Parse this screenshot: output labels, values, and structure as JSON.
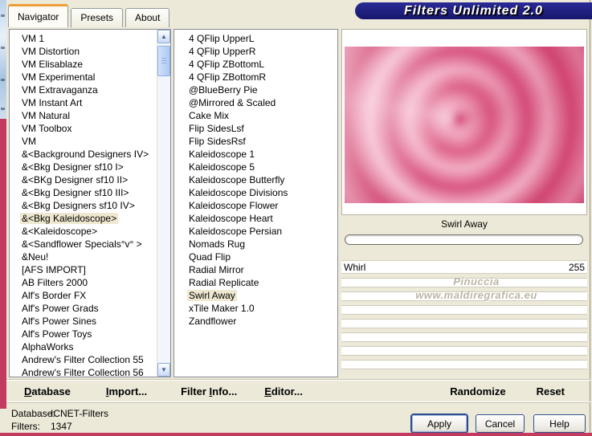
{
  "window": {
    "banner_title": "Filters Unlimited 2.0"
  },
  "tabs": {
    "navigator": {
      "label": "Navigator"
    },
    "presets": {
      "label": "Presets"
    },
    "about": {
      "label": "About"
    }
  },
  "left_list": {
    "items": [
      "VM 1",
      "VM Distortion",
      "VM Elisablaze",
      "VM Experimental",
      "VM Extravaganza",
      "VM Instant Art",
      "VM Natural",
      "VM Toolbox",
      "VM",
      "&<Background Designers IV>",
      "&<Bkg Designer sf10 I>",
      "&<BKg Designer sf10 II>",
      "&<Bkg Designer sf10 III>",
      "&<Bkg Designers sf10 IV>",
      {
        "label": "&<Bkg Kaleidoscope>",
        "selected": true
      },
      "&<Kaleidoscope>",
      "&<Sandflower Specials°v° >",
      "&Neu!",
      "[AFS IMPORT]",
      "AB Filters 2000",
      "Alf's Border FX",
      "Alf's Power Grads",
      "Alf's Power Sines",
      "Alf's Power Toys",
      "AlphaWorks",
      "Andrew's Filter Collection 55",
      "Andrew's Filter Collection 56"
    ]
  },
  "middle_list": {
    "items": [
      "4 QFlip UpperL",
      "4 QFlip UpperR",
      "4 QFlip ZBottomL",
      "4 QFlip ZBottomR",
      "@BlueBerry Pie",
      "@Mirrored & Scaled",
      "Cake Mix",
      "Flip SidesLsf",
      "Flip SidesRsf",
      "Kaleidoscope 1",
      "Kaleidoscope 5",
      "Kaleidoscope Butterfly",
      "Kaleidoscope Divisions",
      "Kaleidoscope Flower",
      "Kaleidoscope Heart",
      "Kaleidoscope Persian",
      "Nomads Rug",
      "Quad Flip",
      "Radial Mirror",
      "Radial Replicate",
      {
        "label": "Swirl Away",
        "selected": true
      },
      "xTile Maker 1.0",
      "Zandflower"
    ]
  },
  "preview": {
    "selected_filter_title": "Swirl Away"
  },
  "parameters": {
    "rows": [
      {
        "name": "Whirl",
        "value": "255"
      }
    ]
  },
  "watermark": {
    "line1": "Pinuccia",
    "line2": "www.maldiregrafica.eu"
  },
  "toolbar": {
    "database": {
      "pre": "",
      "accel": "D",
      "post": "atabase"
    },
    "import": {
      "pre": "",
      "accel": "I",
      "post": "mport..."
    },
    "filter_info": {
      "pre": "Filter ",
      "accel": "I",
      "post": "nfo..."
    },
    "editor": {
      "pre": "",
      "accel": "E",
      "post": "ditor..."
    },
    "randomize": {
      "label": "Randomize"
    },
    "reset": {
      "label": "Reset"
    }
  },
  "status": {
    "database_label": "Database:",
    "database_value": "ICNET-Filters",
    "filters_label": "Filters:",
    "filters_value": "1347"
  },
  "buttons": {
    "apply": "Apply",
    "cancel": "Cancel",
    "help": "Help"
  },
  "icons": {
    "scroll_up": "▲",
    "scroll_down": "▼"
  },
  "colors": {
    "banner_navy": "#1b1b7a",
    "desktop_stripe_red": "#c23a5f",
    "selection_highlight": "#efe8d0",
    "swirl_dark_pink": "#cc3a66",
    "swirl_light_pink": "#f8c8d8"
  }
}
